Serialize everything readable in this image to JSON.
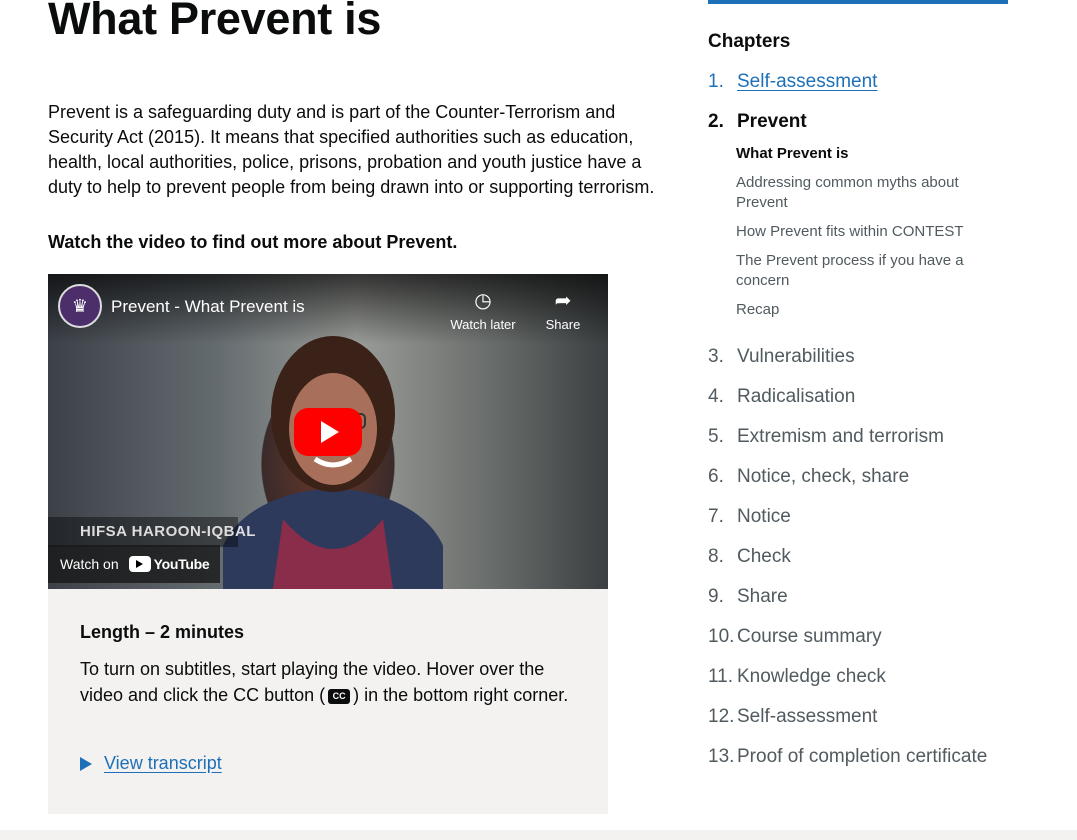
{
  "page": {
    "title": "What Prevent is",
    "intro": "Prevent is a safeguarding duty and is part of the Counter-Terrorism and Security Act (2015). It means that specified authorities such as education, health, local authorities, police, prisons, probation and youth justice have a duty to help to prevent people from being drawn into or supporting terrorism.",
    "watch_prompt": "Watch the video to find out more about Prevent."
  },
  "video": {
    "title": "Prevent - What Prevent is",
    "watch_later": "Watch later",
    "share": "Share",
    "caption_name": "HIFSA HAROON-IQBAL",
    "watch_on": "Watch on",
    "youtube": "YouTube",
    "icons": {
      "channel": "crest-icon",
      "clock": "clock-icon",
      "share": "share-arrow-icon",
      "play": "play-icon"
    }
  },
  "info": {
    "length": "Length – 2 minutes",
    "subtitles_before": "To turn on subtitles, start playing the video. Hover over the video and click the CC button (",
    "cc": "CC",
    "subtitles_after": ") in the bottom right corner.",
    "transcript_link": "View transcript"
  },
  "sidebar": {
    "heading": "Chapters",
    "chapters": [
      {
        "num": "1.",
        "label": "Self-assessment"
      },
      {
        "num": "2.",
        "label": "Prevent"
      },
      {
        "num": "3.",
        "label": "Vulnerabilities"
      },
      {
        "num": "4.",
        "label": "Radicalisation"
      },
      {
        "num": "5.",
        "label": "Extremism and terrorism"
      },
      {
        "num": "6.",
        "label": "Notice, check, share"
      },
      {
        "num": "7.",
        "label": "Notice"
      },
      {
        "num": "8.",
        "label": "Check"
      },
      {
        "num": "9.",
        "label": "Share"
      },
      {
        "num": "10.",
        "label": "Course summary"
      },
      {
        "num": "11.",
        "label": "Knowledge check"
      },
      {
        "num": "12.",
        "label": "Self-assessment"
      },
      {
        "num": "13.",
        "label": "Proof of completion certificate"
      }
    ],
    "subsections": [
      "What Prevent is",
      "Addressing common myths about Prevent",
      "How Prevent fits within CONTEST",
      "The Prevent process if you have a concern",
      "Recap"
    ]
  },
  "colors": {
    "link": "#1d70b8",
    "text": "#0b0c0c",
    "muted": "#505a5f",
    "panel": "#f3f2f1"
  }
}
